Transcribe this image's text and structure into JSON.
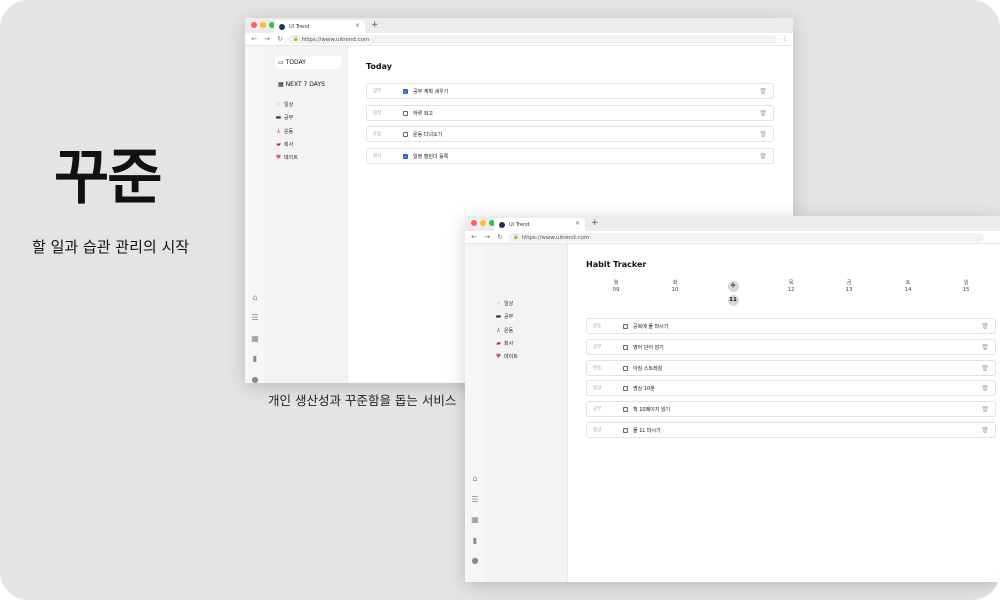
{
  "hero": {
    "title": "꾸준",
    "tagline": "할 일과 습관 관리의 시작",
    "caption": "개인 생산성과 꾸준함을 돕는 서비스"
  },
  "colors": {
    "close": "#ff5f57",
    "minimize": "#febc2e",
    "maximize": "#28c840",
    "check": "#2f5fd6"
  },
  "browser": {
    "tab_title": "UI Trend",
    "url": "https://www.uitrend.com",
    "new_tab": "+",
    "close_tab": "×"
  },
  "rail_icons": [
    "home-icon",
    "list-icon",
    "calendar-icon",
    "chart-icon",
    "user-icon"
  ],
  "categories": [
    {
      "icon": "sparkle-icon",
      "label": "일상"
    },
    {
      "icon": "book-icon",
      "label": "공부"
    },
    {
      "icon": "running-icon",
      "label": "운동"
    },
    {
      "icon": "car-icon",
      "label": "회사"
    },
    {
      "icon": "heart-icon",
      "label": "데이트"
    }
  ],
  "today_window": {
    "nav": [
      {
        "label": "TODAY",
        "active": true
      },
      {
        "label": "NEXT 7 DAYS",
        "active": false
      }
    ],
    "title": "Today",
    "tasks": [
      {
        "tag": "공부",
        "text": "공부 계획 세우기",
        "checked": true
      },
      {
        "tag": "일상",
        "text": "하루 회고",
        "checked": false
      },
      {
        "tag": "운동",
        "text": "운동 다녀오기",
        "checked": false
      },
      {
        "tag": "회사",
        "text": "일정 캘린더 등록",
        "checked": true
      }
    ]
  },
  "habit_window": {
    "title": "Habit Tracker",
    "days": [
      {
        "d": "월",
        "n": "09"
      },
      {
        "d": "화",
        "n": "10"
      },
      {
        "d": "수",
        "n": "11",
        "today": true
      },
      {
        "d": "목",
        "n": "12"
      },
      {
        "d": "금",
        "n": "13"
      },
      {
        "d": "토",
        "n": "14"
      },
      {
        "d": "일",
        "n": "15"
      }
    ],
    "habits": [
      {
        "tag": "운동",
        "text": "공복에 물 마시기",
        "checked": false
      },
      {
        "tag": "공부",
        "text": "영어 단어 암기",
        "checked": false
      },
      {
        "tag": "운동",
        "text": "아침 스트레칭",
        "checked": false
      },
      {
        "tag": "일상",
        "text": "명상 10분",
        "checked": false
      },
      {
        "tag": "공부",
        "text": "책 10페이지 읽기",
        "checked": false
      },
      {
        "tag": "일상",
        "text": "물 1L 마시기",
        "checked": false
      }
    ]
  }
}
